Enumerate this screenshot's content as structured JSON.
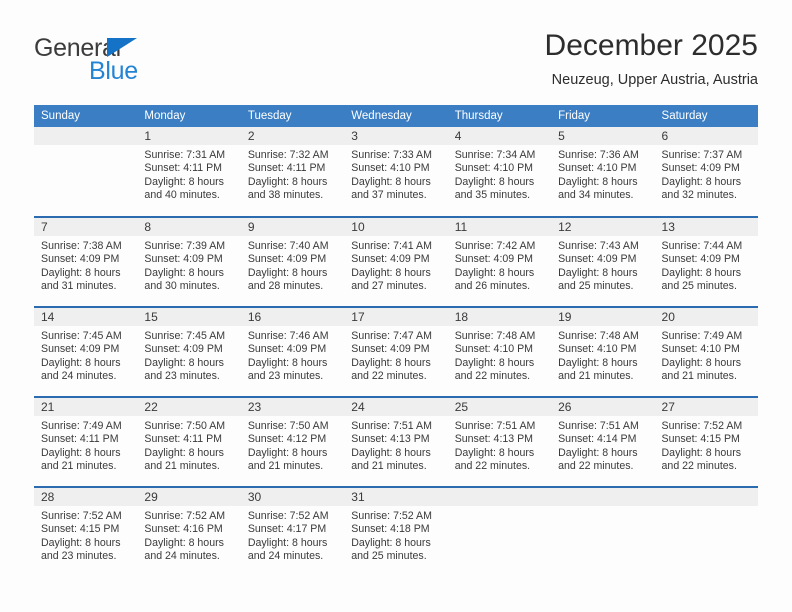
{
  "brand": {
    "name_part1": "General",
    "name_part2": "Blue",
    "triangle_icon": "triangle-icon",
    "accent_color": "#2384d4"
  },
  "header": {
    "title": "December 2025",
    "subtitle": "Neuzeug, Upper Austria, Austria"
  },
  "theme": {
    "header_blue": "#3b7ec4",
    "separator_blue": "#2b6cb0",
    "daynum_band": "#efefef",
    "page_background": "#fdfdfd"
  },
  "calendar": {
    "weekday_headers": [
      "Sunday",
      "Monday",
      "Tuesday",
      "Wednesday",
      "Thursday",
      "Friday",
      "Saturday"
    ],
    "weeks": [
      [
        {
          "day": "",
          "sunrise": "",
          "sunset": "",
          "daylight_line1": "",
          "daylight_line2": ""
        },
        {
          "day": "1",
          "sunrise": "Sunrise: 7:31 AM",
          "sunset": "Sunset: 4:11 PM",
          "daylight_line1": "Daylight: 8 hours",
          "daylight_line2": "and 40 minutes."
        },
        {
          "day": "2",
          "sunrise": "Sunrise: 7:32 AM",
          "sunset": "Sunset: 4:11 PM",
          "daylight_line1": "Daylight: 8 hours",
          "daylight_line2": "and 38 minutes."
        },
        {
          "day": "3",
          "sunrise": "Sunrise: 7:33 AM",
          "sunset": "Sunset: 4:10 PM",
          "daylight_line1": "Daylight: 8 hours",
          "daylight_line2": "and 37 minutes."
        },
        {
          "day": "4",
          "sunrise": "Sunrise: 7:34 AM",
          "sunset": "Sunset: 4:10 PM",
          "daylight_line1": "Daylight: 8 hours",
          "daylight_line2": "and 35 minutes."
        },
        {
          "day": "5",
          "sunrise": "Sunrise: 7:36 AM",
          "sunset": "Sunset: 4:10 PM",
          "daylight_line1": "Daylight: 8 hours",
          "daylight_line2": "and 34 minutes."
        },
        {
          "day": "6",
          "sunrise": "Sunrise: 7:37 AM",
          "sunset": "Sunset: 4:09 PM",
          "daylight_line1": "Daylight: 8 hours",
          "daylight_line2": "and 32 minutes."
        }
      ],
      [
        {
          "day": "7",
          "sunrise": "Sunrise: 7:38 AM",
          "sunset": "Sunset: 4:09 PM",
          "daylight_line1": "Daylight: 8 hours",
          "daylight_line2": "and 31 minutes."
        },
        {
          "day": "8",
          "sunrise": "Sunrise: 7:39 AM",
          "sunset": "Sunset: 4:09 PM",
          "daylight_line1": "Daylight: 8 hours",
          "daylight_line2": "and 30 minutes."
        },
        {
          "day": "9",
          "sunrise": "Sunrise: 7:40 AM",
          "sunset": "Sunset: 4:09 PM",
          "daylight_line1": "Daylight: 8 hours",
          "daylight_line2": "and 28 minutes."
        },
        {
          "day": "10",
          "sunrise": "Sunrise: 7:41 AM",
          "sunset": "Sunset: 4:09 PM",
          "daylight_line1": "Daylight: 8 hours",
          "daylight_line2": "and 27 minutes."
        },
        {
          "day": "11",
          "sunrise": "Sunrise: 7:42 AM",
          "sunset": "Sunset: 4:09 PM",
          "daylight_line1": "Daylight: 8 hours",
          "daylight_line2": "and 26 minutes."
        },
        {
          "day": "12",
          "sunrise": "Sunrise: 7:43 AM",
          "sunset": "Sunset: 4:09 PM",
          "daylight_line1": "Daylight: 8 hours",
          "daylight_line2": "and 25 minutes."
        },
        {
          "day": "13",
          "sunrise": "Sunrise: 7:44 AM",
          "sunset": "Sunset: 4:09 PM",
          "daylight_line1": "Daylight: 8 hours",
          "daylight_line2": "and 25 minutes."
        }
      ],
      [
        {
          "day": "14",
          "sunrise": "Sunrise: 7:45 AM",
          "sunset": "Sunset: 4:09 PM",
          "daylight_line1": "Daylight: 8 hours",
          "daylight_line2": "and 24 minutes."
        },
        {
          "day": "15",
          "sunrise": "Sunrise: 7:45 AM",
          "sunset": "Sunset: 4:09 PM",
          "daylight_line1": "Daylight: 8 hours",
          "daylight_line2": "and 23 minutes."
        },
        {
          "day": "16",
          "sunrise": "Sunrise: 7:46 AM",
          "sunset": "Sunset: 4:09 PM",
          "daylight_line1": "Daylight: 8 hours",
          "daylight_line2": "and 23 minutes."
        },
        {
          "day": "17",
          "sunrise": "Sunrise: 7:47 AM",
          "sunset": "Sunset: 4:09 PM",
          "daylight_line1": "Daylight: 8 hours",
          "daylight_line2": "and 22 minutes."
        },
        {
          "day": "18",
          "sunrise": "Sunrise: 7:48 AM",
          "sunset": "Sunset: 4:10 PM",
          "daylight_line1": "Daylight: 8 hours",
          "daylight_line2": "and 22 minutes."
        },
        {
          "day": "19",
          "sunrise": "Sunrise: 7:48 AM",
          "sunset": "Sunset: 4:10 PM",
          "daylight_line1": "Daylight: 8 hours",
          "daylight_line2": "and 21 minutes."
        },
        {
          "day": "20",
          "sunrise": "Sunrise: 7:49 AM",
          "sunset": "Sunset: 4:10 PM",
          "daylight_line1": "Daylight: 8 hours",
          "daylight_line2": "and 21 minutes."
        }
      ],
      [
        {
          "day": "21",
          "sunrise": "Sunrise: 7:49 AM",
          "sunset": "Sunset: 4:11 PM",
          "daylight_line1": "Daylight: 8 hours",
          "daylight_line2": "and 21 minutes."
        },
        {
          "day": "22",
          "sunrise": "Sunrise: 7:50 AM",
          "sunset": "Sunset: 4:11 PM",
          "daylight_line1": "Daylight: 8 hours",
          "daylight_line2": "and 21 minutes."
        },
        {
          "day": "23",
          "sunrise": "Sunrise: 7:50 AM",
          "sunset": "Sunset: 4:12 PM",
          "daylight_line1": "Daylight: 8 hours",
          "daylight_line2": "and 21 minutes."
        },
        {
          "day": "24",
          "sunrise": "Sunrise: 7:51 AM",
          "sunset": "Sunset: 4:13 PM",
          "daylight_line1": "Daylight: 8 hours",
          "daylight_line2": "and 21 minutes."
        },
        {
          "day": "25",
          "sunrise": "Sunrise: 7:51 AM",
          "sunset": "Sunset: 4:13 PM",
          "daylight_line1": "Daylight: 8 hours",
          "daylight_line2": "and 22 minutes."
        },
        {
          "day": "26",
          "sunrise": "Sunrise: 7:51 AM",
          "sunset": "Sunset: 4:14 PM",
          "daylight_line1": "Daylight: 8 hours",
          "daylight_line2": "and 22 minutes."
        },
        {
          "day": "27",
          "sunrise": "Sunrise: 7:52 AM",
          "sunset": "Sunset: 4:15 PM",
          "daylight_line1": "Daylight: 8 hours",
          "daylight_line2": "and 22 minutes."
        }
      ],
      [
        {
          "day": "28",
          "sunrise": "Sunrise: 7:52 AM",
          "sunset": "Sunset: 4:15 PM",
          "daylight_line1": "Daylight: 8 hours",
          "daylight_line2": "and 23 minutes."
        },
        {
          "day": "29",
          "sunrise": "Sunrise: 7:52 AM",
          "sunset": "Sunset: 4:16 PM",
          "daylight_line1": "Daylight: 8 hours",
          "daylight_line2": "and 24 minutes."
        },
        {
          "day": "30",
          "sunrise": "Sunrise: 7:52 AM",
          "sunset": "Sunset: 4:17 PM",
          "daylight_line1": "Daylight: 8 hours",
          "daylight_line2": "and 24 minutes."
        },
        {
          "day": "31",
          "sunrise": "Sunrise: 7:52 AM",
          "sunset": "Sunset: 4:18 PM",
          "daylight_line1": "Daylight: 8 hours",
          "daylight_line2": "and 25 minutes."
        },
        {
          "day": "",
          "sunrise": "",
          "sunset": "",
          "daylight_line1": "",
          "daylight_line2": ""
        },
        {
          "day": "",
          "sunrise": "",
          "sunset": "",
          "daylight_line1": "",
          "daylight_line2": ""
        },
        {
          "day": "",
          "sunrise": "",
          "sunset": "",
          "daylight_line1": "",
          "daylight_line2": ""
        }
      ]
    ]
  }
}
